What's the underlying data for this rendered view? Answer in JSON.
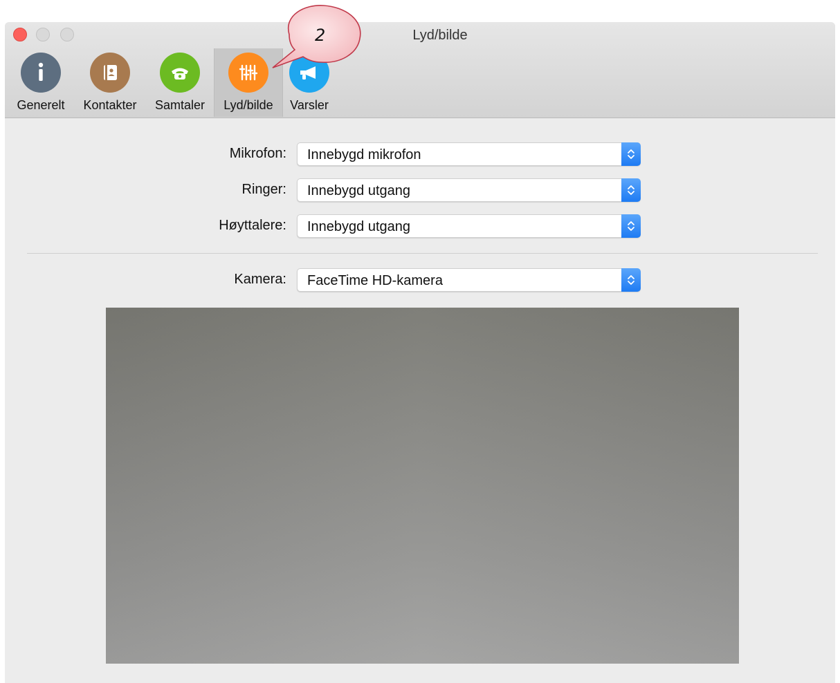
{
  "window": {
    "title": "Lyd/bilde"
  },
  "toolbar": {
    "tabs": [
      {
        "label": "Generelt",
        "icon": "info-icon",
        "color": "#5d6e80"
      },
      {
        "label": "Kontakter",
        "icon": "contacts-book-icon",
        "color": "#a87a4f"
      },
      {
        "label": "Samtaler",
        "icon": "telephone-icon",
        "color": "#6cbb22"
      },
      {
        "label": "Lyd/bilde",
        "icon": "sliders-icon",
        "color": "#fd8b1e",
        "selected": true
      },
      {
        "label": "Varsler",
        "icon": "megaphone-icon",
        "color": "#1fa7ef"
      }
    ]
  },
  "annotation": {
    "text": "2"
  },
  "settings": {
    "mikrofon": {
      "label": "Mikrofon:",
      "value": "Innebygd mikrofon"
    },
    "ringer": {
      "label": "Ringer:",
      "value": "Innebygd utgang"
    },
    "hoyttalere": {
      "label": "Høyttalere:",
      "value": "Innebygd utgang"
    },
    "kamera": {
      "label": "Kamera:",
      "value": "FaceTime HD-kamera"
    }
  },
  "colors": {
    "accent": "#1e7bf3",
    "close": "#fc605b"
  }
}
